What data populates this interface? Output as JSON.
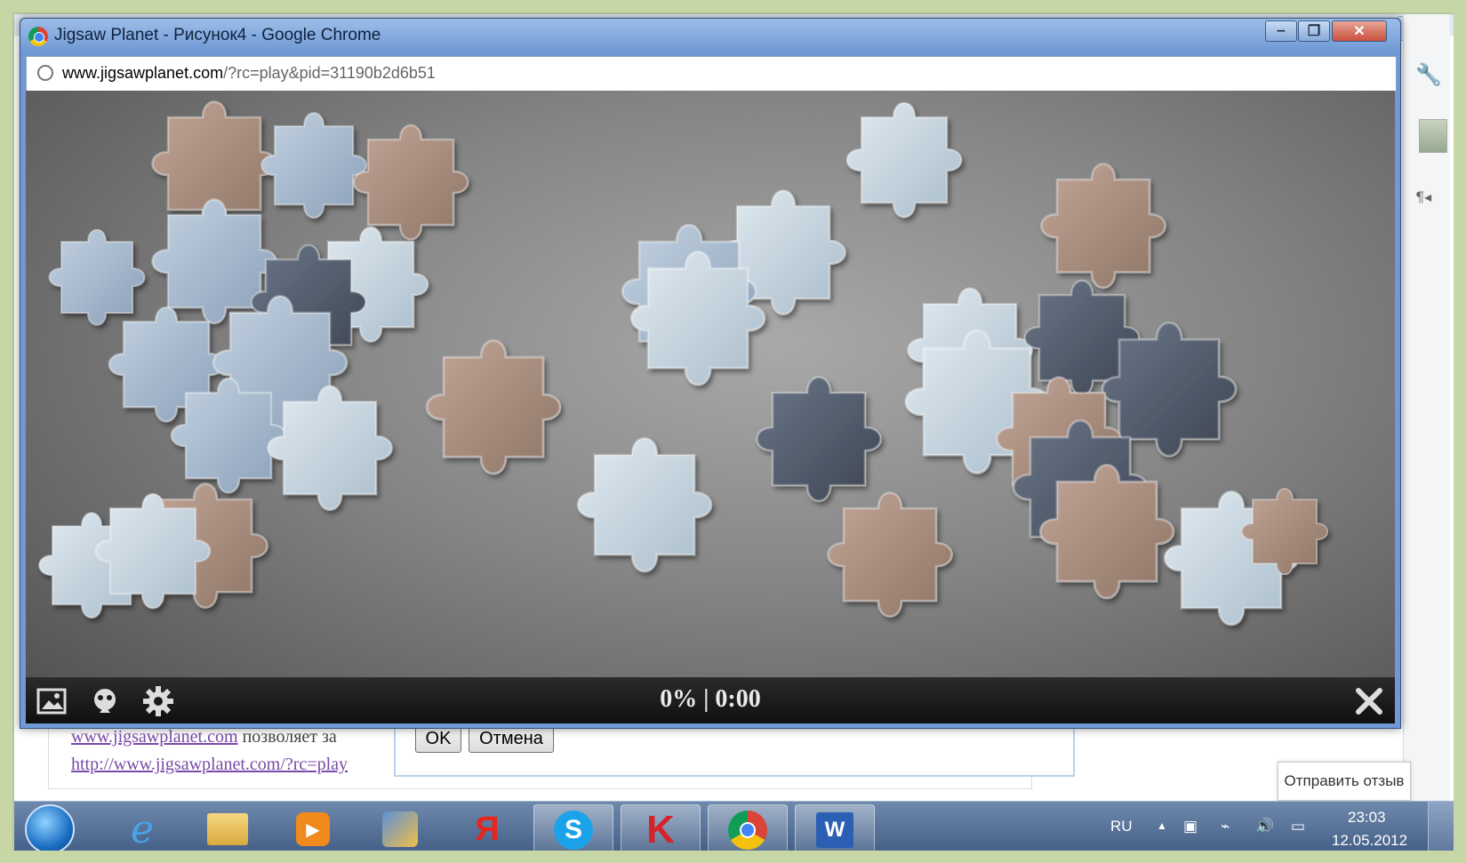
{
  "window": {
    "title": "Jigsaw Planet - Рисунок4 - Google Chrome",
    "minimize_glyph": "‒",
    "maximize_glyph": "❐",
    "close_glyph": "✕"
  },
  "address_bar": {
    "domain": "www.jigsawplanet.com",
    "path": "/?rc=play&pid=31190b2d6b51"
  },
  "game": {
    "status": "0% | 0:00",
    "icons": [
      "image-icon",
      "puzzle-icon",
      "gear-icon",
      "close-icon"
    ]
  },
  "background_doc": {
    "line1_link": "www.jigsawplanet.com",
    "line1_text": " позволяет за",
    "line2_link": "http://www.jigsawplanet.com/?rc=play",
    "ok_label": "OK",
    "cancel_label": "Отмена",
    "feedback_label": "Отправить отзыв",
    "close_glyph": "✕"
  },
  "taskbar": {
    "items": [
      "start-button",
      "internet-explorer",
      "file-explorer",
      "media-player",
      "paint-app",
      "yandex",
      "skype",
      "kaspersky",
      "chrome",
      "word"
    ],
    "language": "RU",
    "time": "23:03",
    "date": "12.05.2012"
  },
  "colors": {
    "titlebar": "#8fb3e3",
    "game_bar": "#1c1c1c",
    "piece_blue": "#9fb4cc",
    "piece_brown": "#a78c7a"
  }
}
